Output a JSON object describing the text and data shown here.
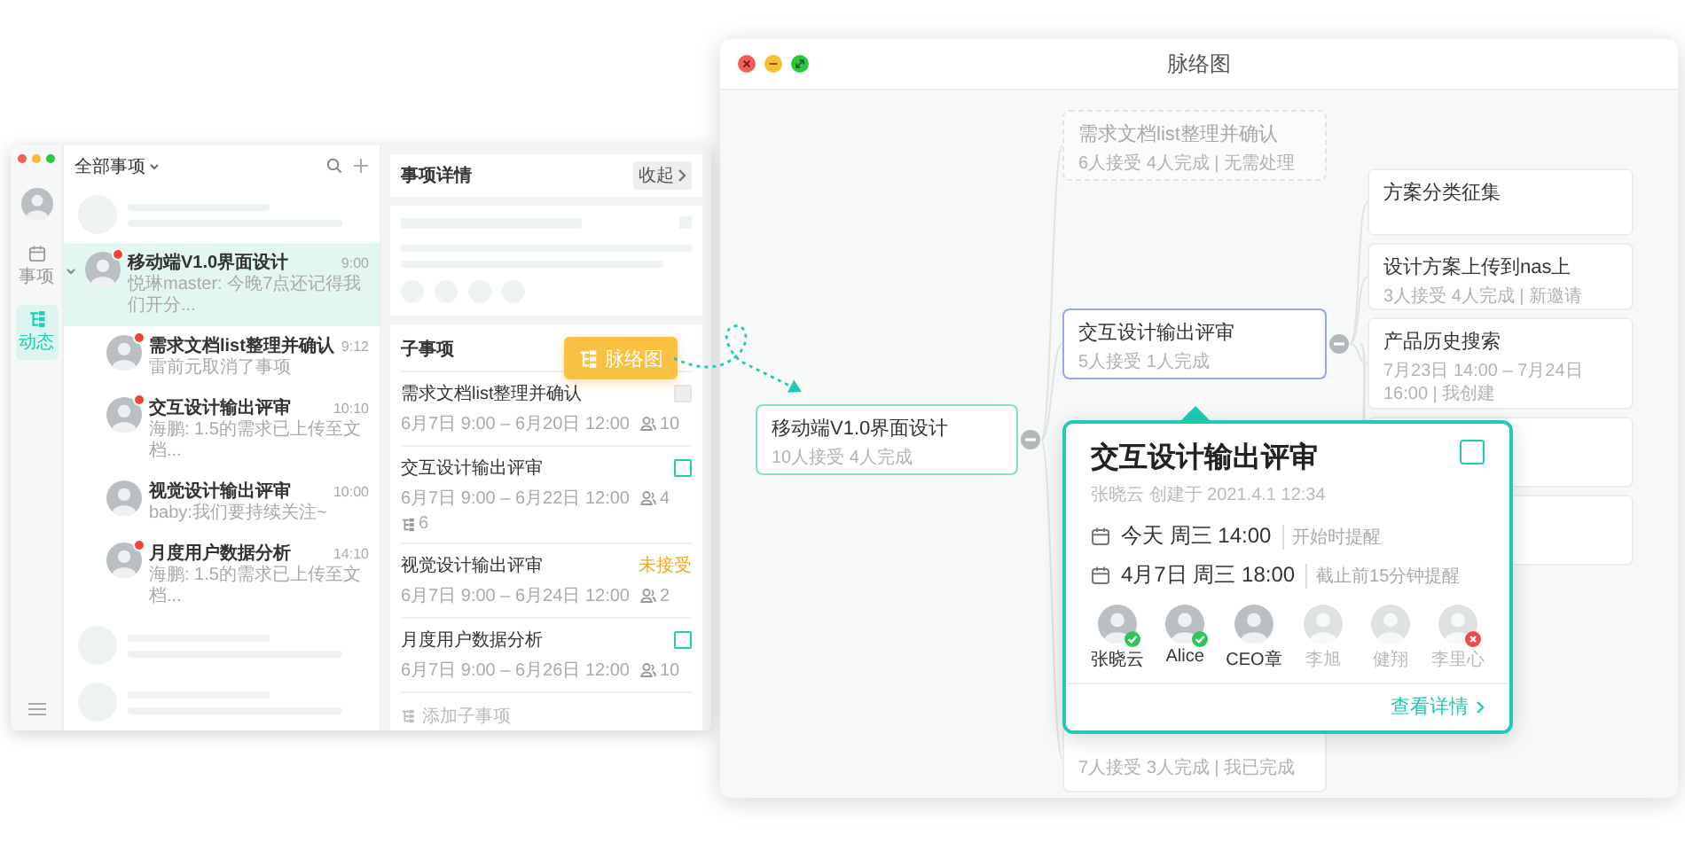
{
  "app": {
    "sidebar": {
      "items": [
        {
          "label": "事项",
          "selected": false
        },
        {
          "label": "动态",
          "selected": true
        }
      ]
    },
    "list": {
      "filter": "全部事项",
      "items": [
        {
          "title": "移动端V1.0界面设计",
          "time": "9:00",
          "preview": "悦琳master: 今晚7点还记得我们开分...",
          "unread": true,
          "selected": true,
          "expanded": true,
          "children": [
            {
              "title": "需求文档list整理并确认",
              "time": "9:12",
              "preview": "雷前元取消了事项",
              "unread": true,
              "selected": false
            },
            {
              "title": "交互设计输出评审",
              "time": "10:10",
              "preview": "海鹏: 1.5的需求已上传至文档...",
              "unread": true,
              "selected": false
            },
            {
              "title": "视觉设计输出评审",
              "time": "10:00",
              "preview": "baby:我们要持续关注~",
              "unread": false,
              "selected": false
            },
            {
              "title": "月度用户数据分析",
              "time": "14:10",
              "preview": "海鹏: 1.5的需求已上传至文档...",
              "unread": true,
              "selected": false
            }
          ]
        }
      ]
    },
    "detail": {
      "title": "事项详情",
      "collapse": "收起",
      "section": "子事项",
      "subtasks": [
        {
          "title": "需求文档list整理并确认",
          "time": "6月7日 9:00 – 6月20日 12:00",
          "people": "10",
          "kind": "checkbox",
          "disabled": true
        },
        {
          "title": "交互设计输出评审",
          "time": "6月7日 9:00 – 6月22日 12:00",
          "people": "4",
          "subtasks": "6",
          "kind": "checkbox",
          "disabled": false
        },
        {
          "title": "视觉设计输出评审",
          "time": "6月7日 9:00 – 6月24日 12:00",
          "people": "2",
          "kind": "tag",
          "tag": "未接受"
        },
        {
          "title": "月度用户数据分析",
          "time": "6月7日 9:00 – 6月26日 12:00",
          "people": "10",
          "kind": "checkbox",
          "disabled": false
        }
      ],
      "add": "添加子事项"
    }
  },
  "badge": {
    "label": "脉络图"
  },
  "mindmap": {
    "title": "脉络图",
    "root": {
      "title": "移动端V1.0界面设计",
      "meta": "10人接受 4人完成",
      "kind": "root",
      "expanded": true,
      "children": [
        {
          "title": "需求文档list整理并确认",
          "meta": "6人接受 4人完成 | 无需处理",
          "kind": "dimmed"
        },
        {
          "title": "交互设计输出评审",
          "meta": "5人接受 1人完成",
          "kind": "focused",
          "expanded": true,
          "children": [
            {
              "title": "方案分类征集"
            },
            {
              "title": "设计方案上传到nas上",
              "meta": "3人接受 4人完成 | 新邀请"
            },
            {
              "title": "产品历史搜索",
              "meta": "7月23日 14:00 – 7月24日 16:00 | 我创建"
            }
          ]
        },
        {
          "meta": "7人接受 3人完成 | 我已完成"
        }
      ]
    },
    "popover": {
      "title": "交互设计输出评审",
      "creator": "张晓云 创建于 2021.4.1 12:34",
      "checked": false,
      "schedule": [
        {
          "date": "今天 周三 14:00",
          "reminder": "开始时提醒"
        },
        {
          "date": "4月7日 周三 18:00",
          "reminder": "截止前15分钟提醒"
        }
      ],
      "members": [
        {
          "name": "张晓云",
          "accepted": true,
          "declined": false,
          "viewed": true
        },
        {
          "name": "Alice",
          "accepted": true,
          "declined": false,
          "viewed": true
        },
        {
          "name": "CEO章",
          "accepted": false,
          "declined": false,
          "viewed": true
        },
        {
          "name": "李旭",
          "accepted": false,
          "declined": false,
          "viewed": false
        },
        {
          "name": "健翔",
          "accepted": false,
          "declined": false,
          "viewed": false
        },
        {
          "name": "李里心",
          "accepted": false,
          "declined": true,
          "viewed": false
        }
      ],
      "link": "查看详情"
    }
  }
}
